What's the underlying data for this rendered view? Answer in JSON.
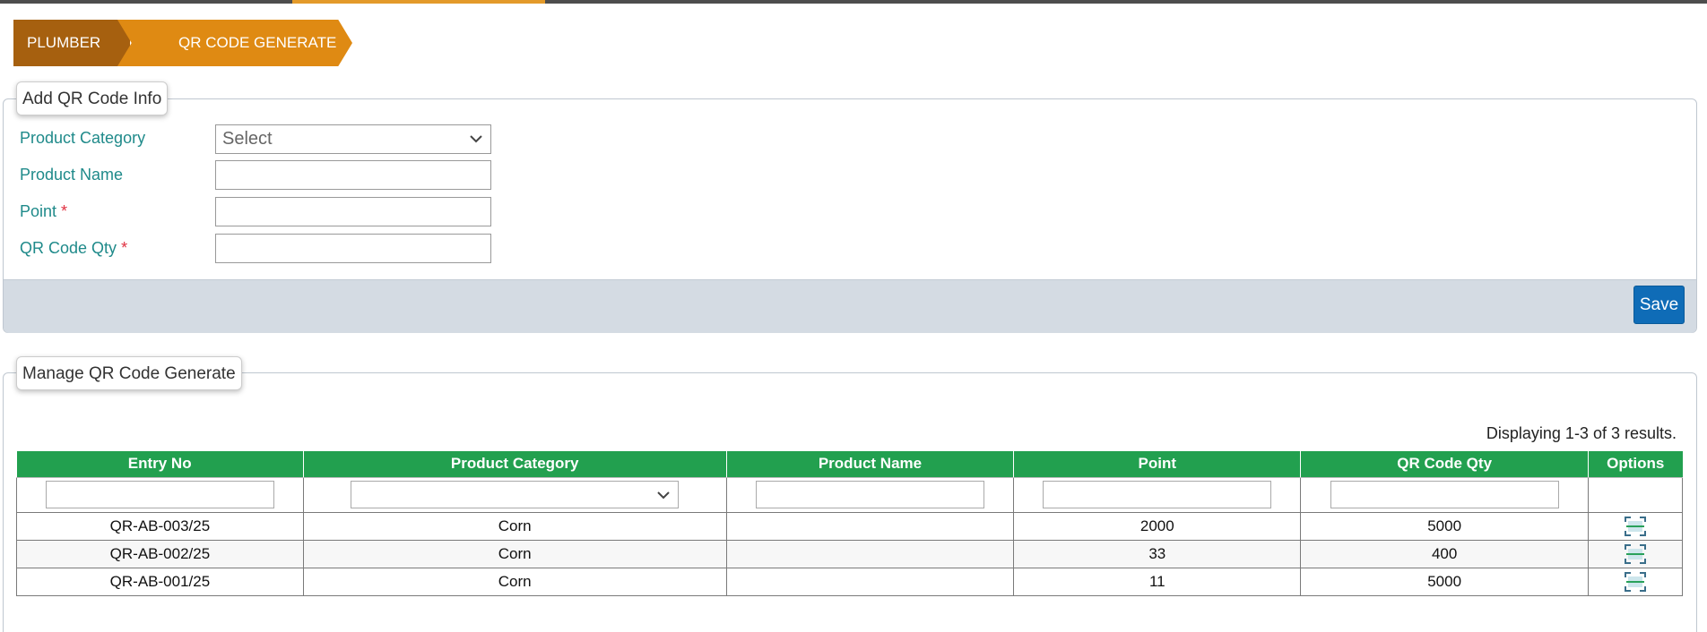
{
  "breadcrumb": {
    "item1": "PLUMBER",
    "item2": "QR CODE GENERATE"
  },
  "form": {
    "legend": "Add QR Code Info",
    "product_category_label": "Product Category",
    "product_category_value": "Select",
    "product_name_label": "Product Name",
    "point_label": "Point",
    "qr_qty_label": "QR Code Qty",
    "required_marker": "*",
    "save_label": "Save"
  },
  "manage": {
    "legend": "Manage QR Code Generate",
    "results_text": "Displaying 1-3 of 3 results.",
    "columns": [
      "Entry No",
      "Product Category",
      "Product Name",
      "Point",
      "QR Code Qty",
      "Options"
    ],
    "rows": [
      {
        "entry_no": "QR-AB-003/25",
        "category": "Corn",
        "product_name": "",
        "point": "2000",
        "qty": "5000"
      },
      {
        "entry_no": "QR-AB-002/25",
        "category": "Corn",
        "product_name": "",
        "point": "33",
        "qty": "400"
      },
      {
        "entry_no": "QR-AB-001/25",
        "category": "Corn",
        "product_name": "",
        "point": "11",
        "qty": "5000"
      }
    ]
  },
  "colors": {
    "crumb_dark": "#a6600f",
    "crumb_light": "#df8a13",
    "header_green": "#22a04f",
    "label_teal": "#1f8a8a",
    "save_blue": "#0f6cb7",
    "required_red": "#e03040"
  },
  "icons": {
    "options": "qr-scan-icon",
    "dropdown": "chevron-down-icon"
  }
}
